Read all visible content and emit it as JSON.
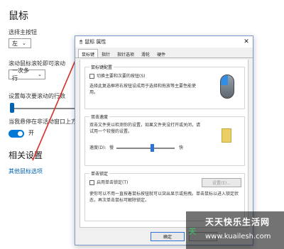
{
  "settings": {
    "title": "鼠标",
    "primary_button_label": "选择主按钮",
    "primary_button_value": "左",
    "scroll_label": "滚动鼠标滚轮即可滚动",
    "scroll_value": "一次多行",
    "lines_label": "设置每次要滚动的行数",
    "inactive_label": "当我悬停在非活动窗口上方",
    "toggle_state": "开",
    "related_heading": "相关设置",
    "other_options_link": "其他鼠标选项"
  },
  "dialog": {
    "title": "鼠标 属性",
    "close_glyph": "✕",
    "tabs": [
      "鼠标键",
      "指针",
      "指针选项",
      "滑轮",
      "硬件"
    ],
    "active_tab": 0,
    "button_config": {
      "title": "鼠标键配置",
      "checkbox_label": "切换主要和次要的按钮(S)",
      "description": "选择此复选框将右按钮设成用于选择和拖放等主要性能使用。"
    },
    "double_click": {
      "title": "双击速度",
      "description": "双击文件夹以检测你的设置，如果文件夹没打开或关闭，请试用一个较慢的设置。",
      "speed_label": "速度(D):",
      "slow": "慢",
      "fast": "快",
      "speed_fraction": 0.62
    },
    "click_lock": {
      "title": "单击锁定",
      "checkbox_label": "启用单击锁定(T)",
      "settings_button": "设置(E)...",
      "description": "使你可以不用一直按着鼠标按钮就可以突出显示或拖拽。单击鼠标以进入锁定状态，再次单击鼠标可解除锁定。"
    },
    "ok_button": "确定"
  },
  "watermark": {
    "title": "天天快乐生活网",
    "url": "www.kuailesh.com",
    "logo_text": "天"
  },
  "colors": {
    "accent": "#0078d7",
    "arrow": "#d9302c"
  }
}
